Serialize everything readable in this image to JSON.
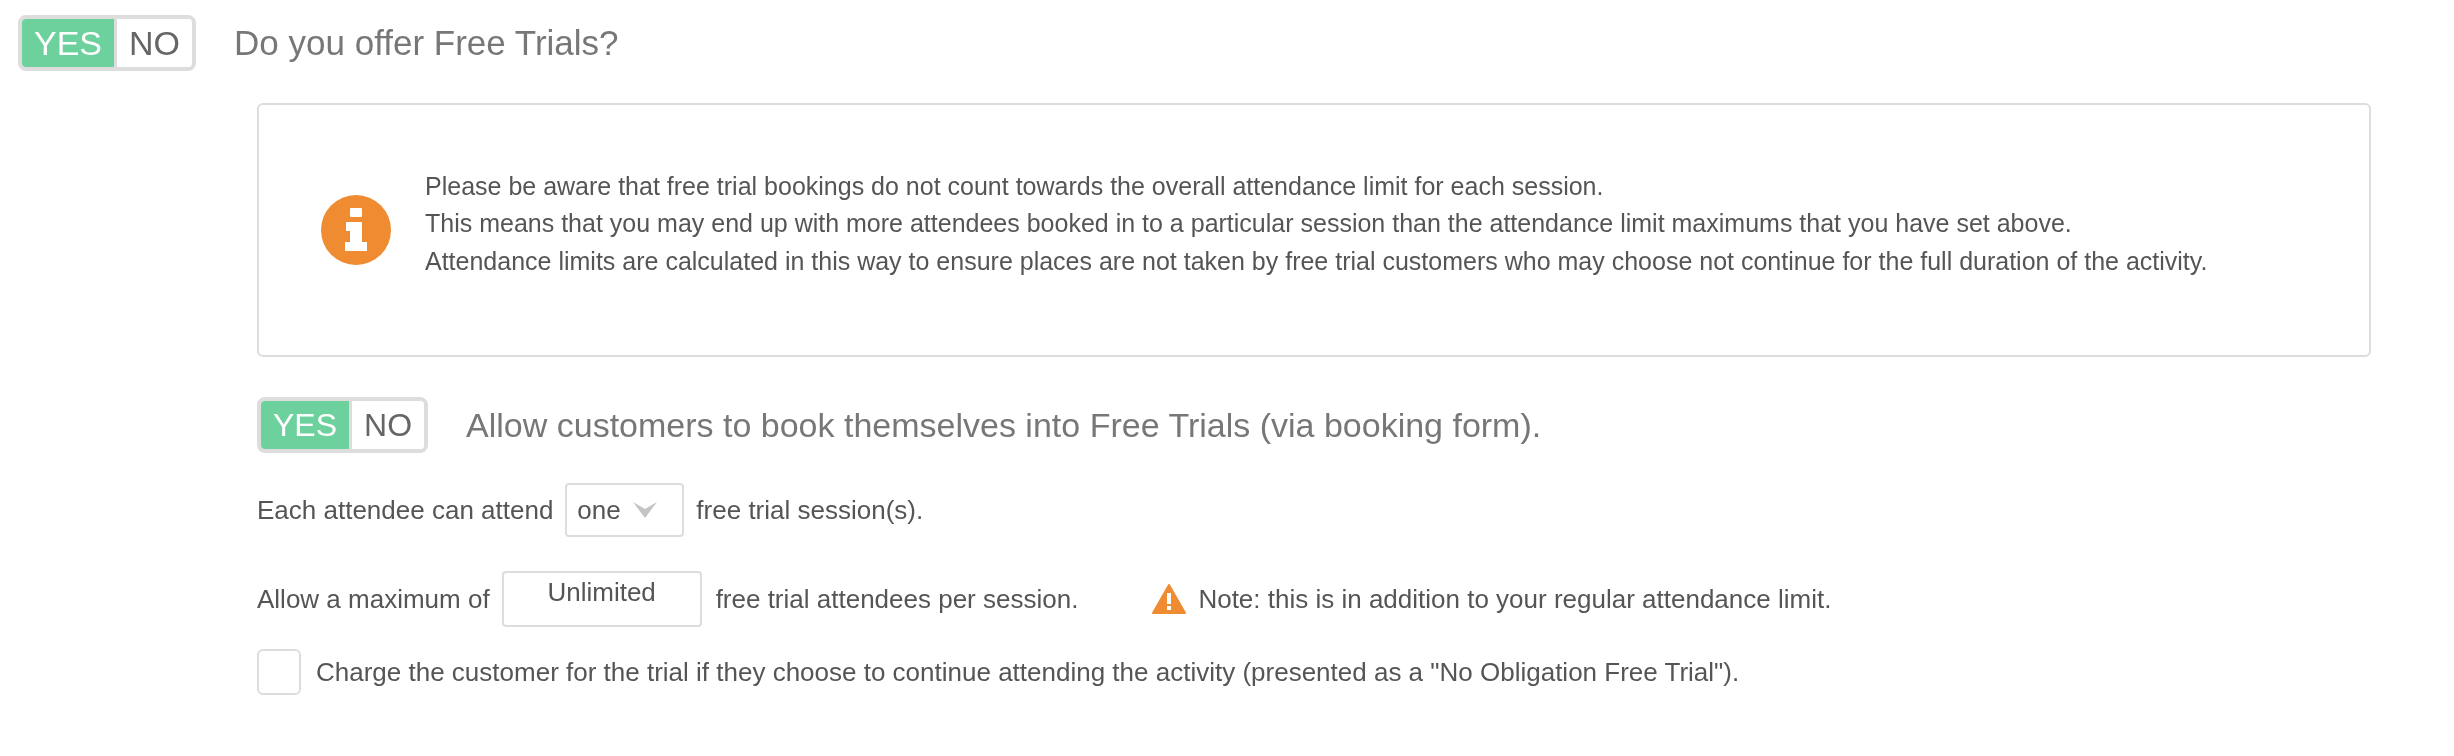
{
  "main_toggle": {
    "options": [
      {
        "label": "YES",
        "selected": true
      },
      {
        "label": "NO",
        "selected": false
      }
    ],
    "question": "Do you offer Free Trials?"
  },
  "info_box": {
    "paragraphs": [
      "Please be aware that free trial bookings do not count towards the overall attendance limit for each session.",
      "This means that you may end up with more attendees booked in to a particular session than the attendance limit maximums that you have set above.",
      "Attendance limits are calculated in this way to ensure places are not taken by free trial customers who may choose not continue for the full duration of the activity."
    ]
  },
  "self_booking": {
    "options": [
      {
        "label": "YES",
        "selected": true
      },
      {
        "label": "NO",
        "selected": false
      }
    ],
    "label": "Allow customers to book themselves into Free Trials (via booking form)."
  },
  "sessions_row": {
    "before": "Each attendee can attend",
    "select_value": "one",
    "after": "free trial session(s)."
  },
  "maximum_row": {
    "before": "Allow a maximum of",
    "input_value": "Unlimited",
    "after": "free trial attendees per session.",
    "note": "Note: this is in addition to your regular attendance limit."
  },
  "charge_option": {
    "checked": false,
    "label": "Charge the customer for the trial if they choose to continue attending the activity (presented as a \"No Obligation Free Trial\")."
  }
}
